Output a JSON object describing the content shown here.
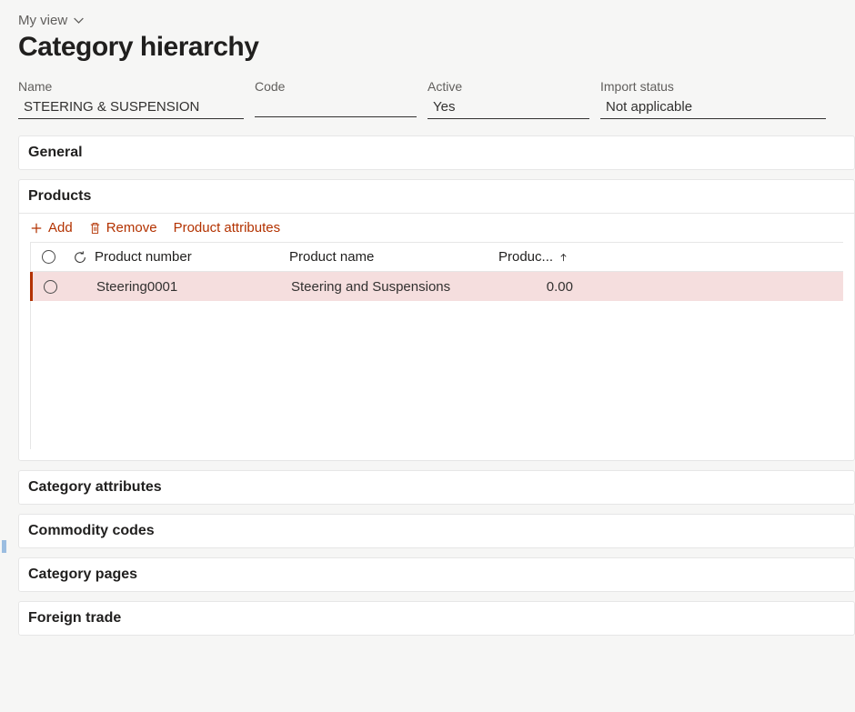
{
  "header": {
    "view_selector": "My view",
    "title": "Category hierarchy"
  },
  "fields": {
    "name": {
      "label": "Name",
      "value": "STEERING & SUSPENSION"
    },
    "code": {
      "label": "Code",
      "value": ""
    },
    "active": {
      "label": "Active",
      "value": "Yes"
    },
    "import": {
      "label": "Import status",
      "value": "Not applicable"
    }
  },
  "sections": {
    "general": "General",
    "products": "Products",
    "category_attributes": "Category attributes",
    "commodity_codes": "Commodity codes",
    "category_pages": "Category pages",
    "foreign_trade": "Foreign trade"
  },
  "products_toolbar": {
    "add": "Add",
    "remove": "Remove",
    "attrs": "Product attributes"
  },
  "products_grid": {
    "columns": {
      "product_number": "Product number",
      "product_name": "Product name",
      "product_sortcol": "Produc..."
    },
    "rows": [
      {
        "number": "Steering0001",
        "name": "Steering and Suspensions",
        "value": "0.00"
      }
    ]
  }
}
